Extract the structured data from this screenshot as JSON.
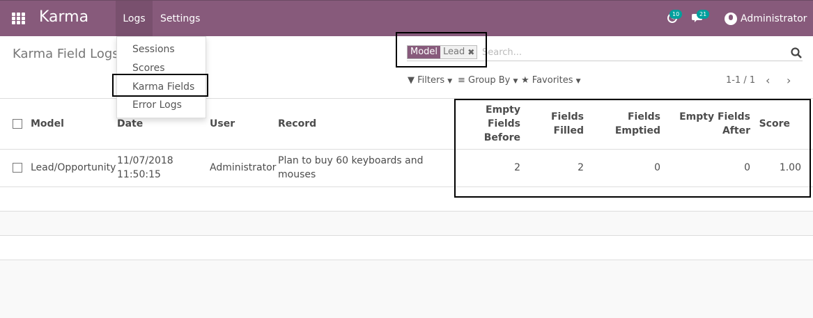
{
  "app": {
    "brand": "Karma",
    "menu_logs": "Logs",
    "menu_settings": "Settings"
  },
  "systray": {
    "activity_count": "10",
    "messages_count": "21",
    "user_name": "Administrator"
  },
  "dropdown": {
    "items": [
      "Sessions",
      "Scores",
      "Karma Fields",
      "Error Logs"
    ]
  },
  "control": {
    "title": "Karma Field Logs",
    "facet_label": "Model",
    "facet_value": "Lead",
    "search_placeholder": "Search...",
    "filters": "Filters",
    "group_by": "Group By",
    "favorites": "Favorites",
    "pager": "1-1 / 1"
  },
  "table": {
    "headers": {
      "model": "Model",
      "date": "Date",
      "user": "User",
      "record": "Record",
      "empty_before_1": "Empty Fields",
      "empty_before_2": "Before",
      "filled_1": "Fields",
      "filled_2": "Filled",
      "emptied_1": "Fields",
      "emptied_2": "Emptied",
      "empty_after_1": "Empty Fields",
      "empty_after_2": "After",
      "score": "Score"
    },
    "rows": [
      {
        "model": "Lead/Opportunity",
        "date_1": "11/07/2018",
        "date_2": "11:50:15",
        "user": "Administrator",
        "record_1": "Plan to buy 60 keyboards and",
        "record_2": "mouses",
        "empty_before": "2",
        "filled": "2",
        "emptied": "0",
        "empty_after": "0",
        "score": "1.00"
      }
    ]
  }
}
